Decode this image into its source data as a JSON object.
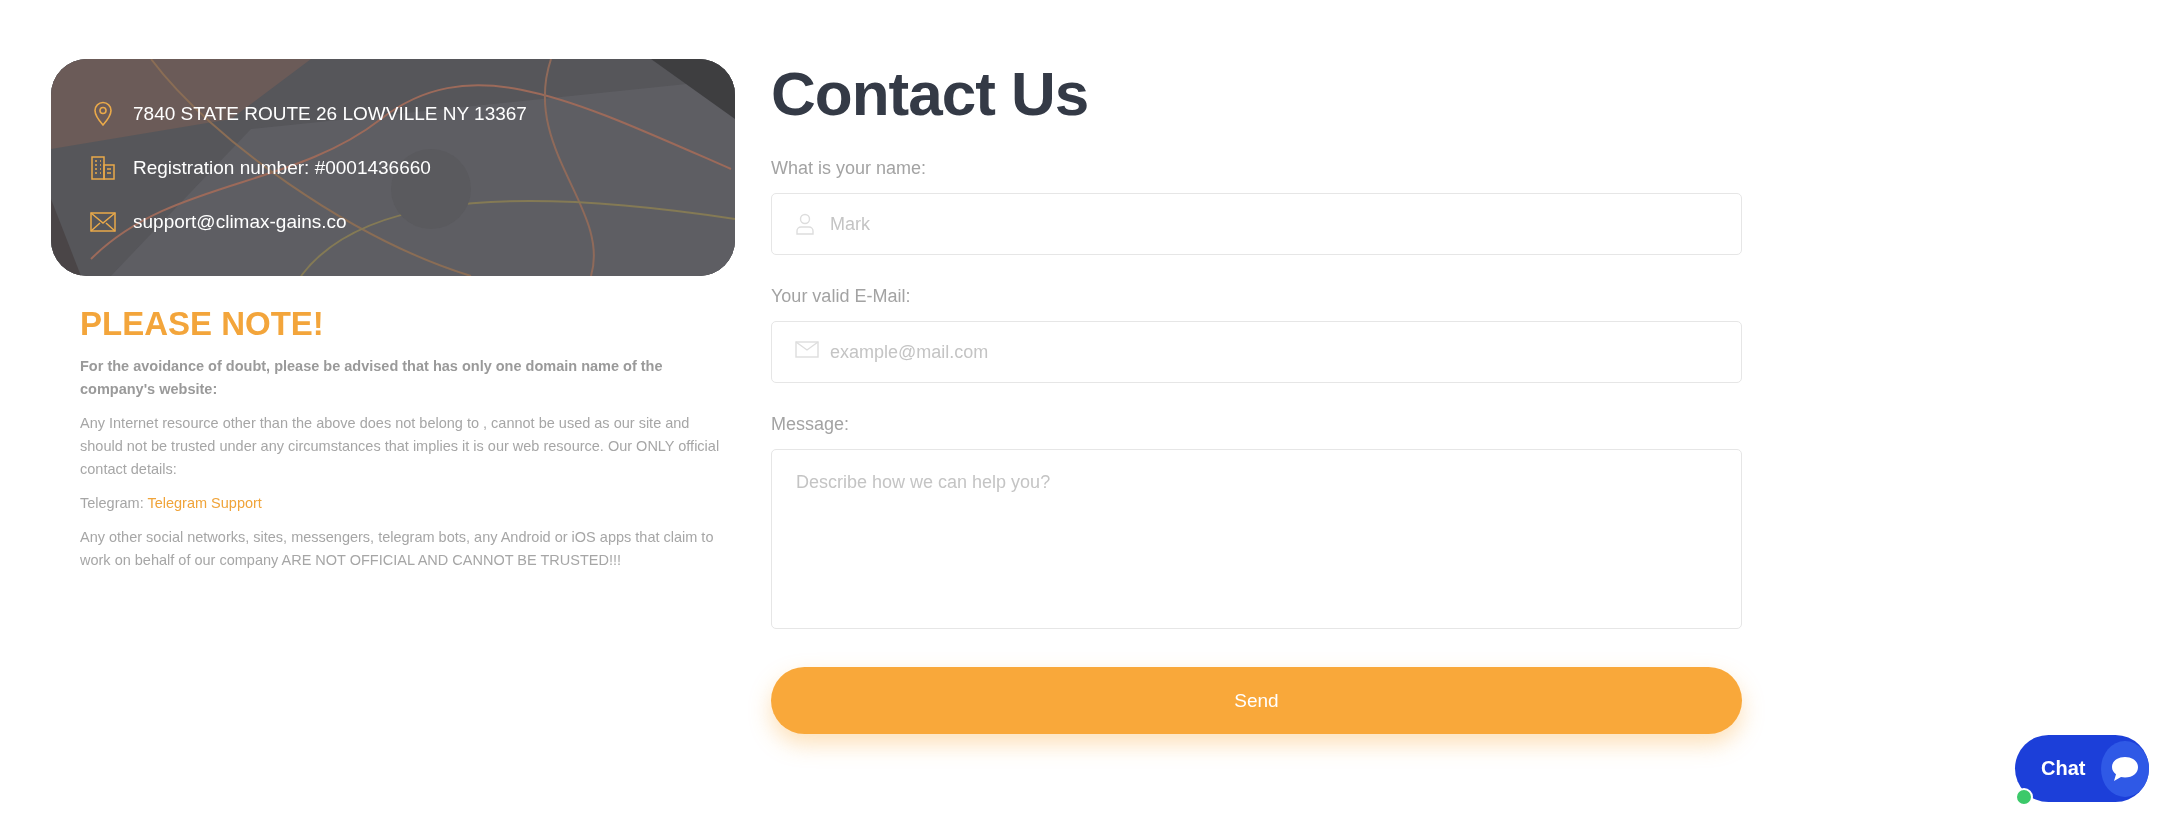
{
  "contact_card": {
    "items": [
      {
        "kind": "address",
        "text": "7840 STATE ROUTE 26 LOWVILLE NY 13367"
      },
      {
        "kind": "registration",
        "text": "Registration number: #0001436660"
      },
      {
        "kind": "email",
        "text": "support@climax-gains.co"
      }
    ]
  },
  "notice": {
    "heading": "PLEASE NOTE!",
    "intro": "For the avoidance of doubt, please be advised that has only one domain name of the company's website:",
    "body": "Any Internet resource other than the above does not belong to , cannot be used as our site and should not be trusted under any circumstances that implies it is our web resource. Our ONLY official contact details:",
    "telegram_label": "Telegram:",
    "telegram_link": "Telegram Support",
    "warning": "Any other social networks, sites, messengers, telegram bots, any Android or iOS apps that claim to work on behalf of our company ARE NOT OFFICIAL AND CANNOT BE TRUSTED!!!"
  },
  "form": {
    "title": "Contact Us",
    "fields": [
      {
        "kind": "name",
        "label": "What is your name:",
        "placeholder": "Mark"
      },
      {
        "kind": "email",
        "label": "Your valid E-Mail:",
        "placeholder": "example@mail.com"
      },
      {
        "kind": "message",
        "label": "Message:",
        "placeholder": "Describe how we can help you?"
      }
    ],
    "submit": "Send"
  },
  "chat": {
    "label": "Chat",
    "online": true
  }
}
